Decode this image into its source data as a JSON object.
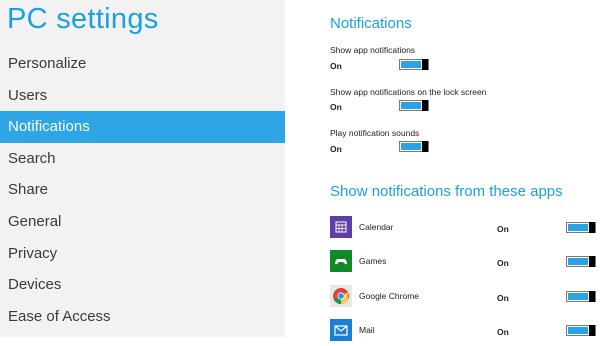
{
  "sidebar": {
    "title": "PC settings",
    "items": [
      {
        "label": "Personalize"
      },
      {
        "label": "Users"
      },
      {
        "label": "Notifications"
      },
      {
        "label": "Search"
      },
      {
        "label": "Share"
      },
      {
        "label": "General"
      },
      {
        "label": "Privacy"
      },
      {
        "label": "Devices"
      },
      {
        "label": "Ease of Access"
      }
    ],
    "active_item": "Notifications"
  },
  "notifications": {
    "heading": "Notifications",
    "settings": [
      {
        "label": "Show app notifications",
        "state": "On"
      },
      {
        "label": "Show app notifications on the lock screen",
        "state": "On"
      },
      {
        "label": "Play notification sounds",
        "state": "On"
      }
    ]
  },
  "apps": {
    "heading": "Show notifications from these apps",
    "list": [
      {
        "name": "Calendar",
        "state": "On",
        "icon": "calendar-icon",
        "icon_color": "#5f3ea8"
      },
      {
        "name": "Games",
        "state": "On",
        "icon": "games-controller-icon",
        "icon_color": "#0f8a26"
      },
      {
        "name": "Google Chrome",
        "state": "On",
        "icon": "chrome-icon",
        "icon_color": "#e8e8e8"
      },
      {
        "name": "Mail",
        "state": "On",
        "icon": "mail-icon",
        "icon_color": "#1b7fd6"
      }
    ]
  },
  "colors": {
    "accent": "#1ba1e2",
    "selection": "#2ea6e6",
    "toggle_on": "#29a3e6",
    "sidebar_bg": "#f2f2f2"
  }
}
